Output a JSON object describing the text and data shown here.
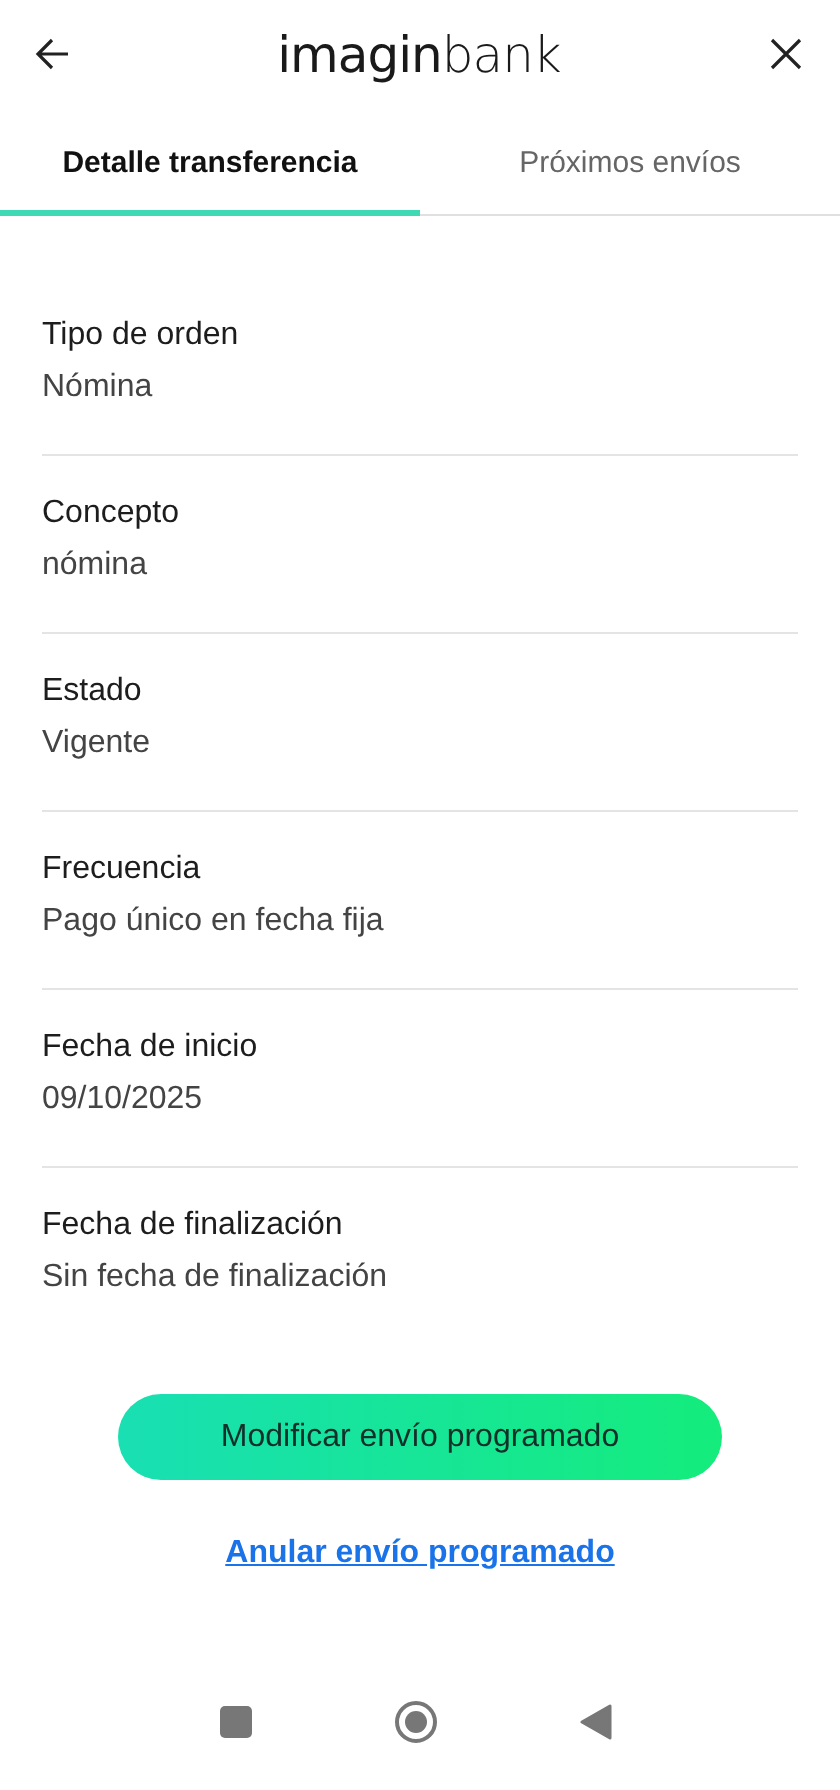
{
  "header": {
    "logo": "**imagin**bank"
  },
  "tabs": [
    {
      "label": "Detalle transferencia",
      "selected": true
    },
    {
      "label": "Próximos envíos",
      "selected": false
    }
  ],
  "details": [
    {
      "label": "Tipo de orden",
      "value": "Nómina"
    },
    {
      "label": "Concepto",
      "value": "nómina"
    },
    {
      "label": "Estado",
      "value": "Vigente"
    },
    {
      "label": "Frecuencia",
      "value": "Pago único en fecha fija"
    },
    {
      "label": "Fecha de inicio",
      "value": "09/10/2025"
    },
    {
      "label": "Fecha de finalización",
      "value": "Sin fecha de finalización"
    }
  ],
  "primary_button": "Modificar envío programado",
  "link": "Anular envío programado"
}
